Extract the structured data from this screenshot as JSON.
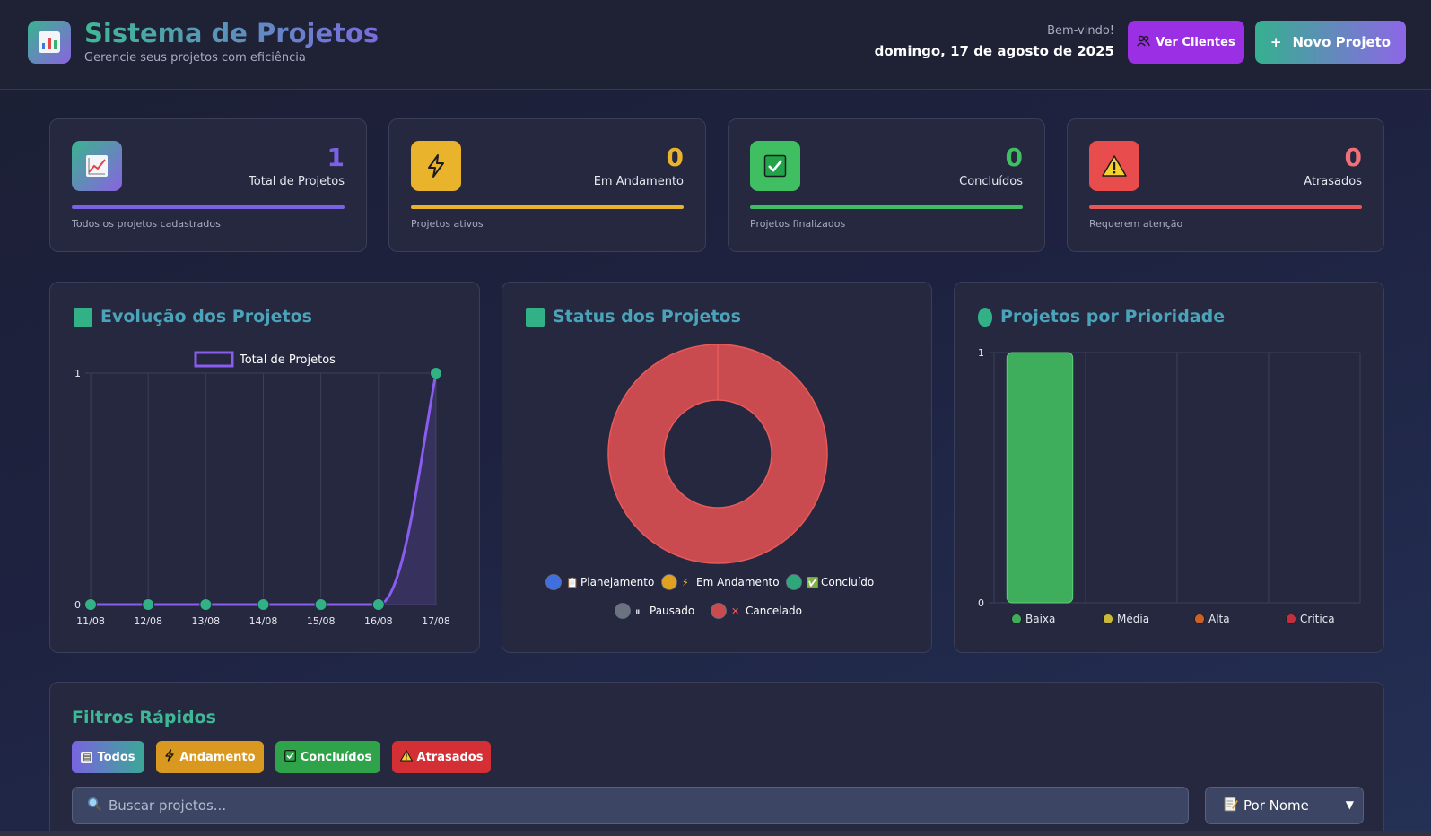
{
  "header": {
    "title": "Sistema de Projetos",
    "subtitle": "Gerencie seus projetos com eficiência",
    "welcome": "Bem-vindo!",
    "date": "domingo, 17 de agosto de 2025",
    "clients_button": "Ver Clientes",
    "new_project_button": "Novo Projeto",
    "new_project_prefix": "+"
  },
  "stats": [
    {
      "value": "1",
      "label": "Total de Projetos",
      "desc": "Todos os projetos cadastrados",
      "color": "#7b61e4",
      "icon": "chart-up-icon"
    },
    {
      "value": "0",
      "label": "Em Andamento",
      "desc": "Projetos ativos",
      "color": "#eab32c",
      "icon": "lightning-icon"
    },
    {
      "value": "0",
      "label": "Concluídos",
      "desc": "Projetos finalizados",
      "color": "#3fbf62",
      "icon": "check-icon"
    },
    {
      "value": "0",
      "label": "Atrasados",
      "desc": "Requerem atenção",
      "color": "#e85656",
      "icon": "warning-icon"
    }
  ],
  "charts": {
    "evolution_title": "Evolução dos Projetos",
    "status_title": "Status dos Projetos",
    "priority_title": "Projetos por Prioridade"
  },
  "chart_data": [
    {
      "type": "line",
      "legend": [
        "Total de Projetos"
      ],
      "x": [
        "11/08",
        "12/08",
        "13/08",
        "14/08",
        "15/08",
        "16/08",
        "17/08"
      ],
      "series": [
        {
          "name": "Total de Projetos",
          "values": [
            0,
            0,
            0,
            0,
            0,
            0,
            1
          ]
        }
      ],
      "ylim": [
        0,
        1
      ],
      "yticks": [
        "0",
        "1"
      ],
      "grid": true,
      "legend_position": "top",
      "colors": {
        "line": "#8a5cf0",
        "point": "#33b186"
      }
    },
    {
      "type": "pie",
      "categories": [
        "Planejamento",
        "Em Andamento",
        "Concluído",
        "Pausado",
        "Cancelado"
      ],
      "values": [
        0,
        0,
        0,
        0,
        1
      ],
      "colors": [
        "#3f6fe0",
        "#e0a020",
        "#2fa77a",
        "#6b7280",
        "#c94a4f"
      ],
      "legend_icons": [
        "📋",
        "⚡",
        "✅",
        "⏸",
        "✕"
      ],
      "legend_position": "bottom",
      "donut": true
    },
    {
      "type": "bar",
      "categories": [
        "Baixa",
        "Média",
        "Alta",
        "Crítica"
      ],
      "values": [
        1,
        0,
        0,
        0
      ],
      "colors": [
        "#3fae5c",
        "#c9b83a",
        "#c9612b",
        "#c0303f"
      ],
      "ylim": [
        0,
        1
      ],
      "yticks": [
        "0",
        "1"
      ],
      "grid": true,
      "legend_position": "bottom"
    }
  ],
  "filters": {
    "title": "Filtros Rápidos",
    "buttons": [
      {
        "label": "Todos",
        "icon": "clipboard-icon"
      },
      {
        "label": "Andamento",
        "icon": "lightning-icon"
      },
      {
        "label": "Concluídos",
        "icon": "check-icon"
      },
      {
        "label": "Atrasados",
        "icon": "warning-icon"
      }
    ],
    "search_placeholder": "Buscar projetos...",
    "sort_selected": "Por Nome"
  }
}
